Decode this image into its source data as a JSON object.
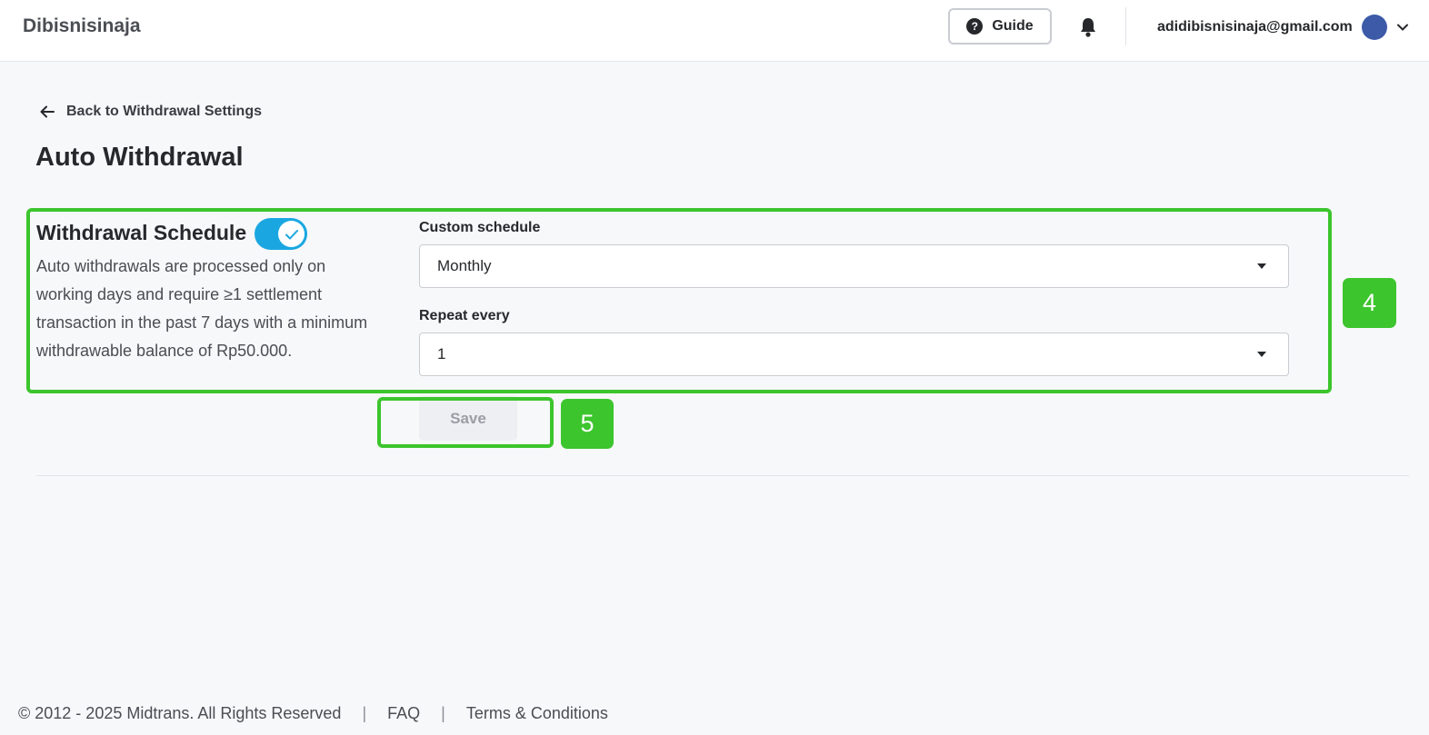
{
  "header": {
    "brand": "Dibisnisinaja",
    "guide_label": "Guide",
    "user_email": "adidibisnisinaja@gmail.com"
  },
  "nav": {
    "back_label": "Back to Withdrawal Settings"
  },
  "page": {
    "title": "Auto Withdrawal"
  },
  "schedule": {
    "title": "Withdrawal Schedule",
    "enabled": true,
    "description": "Auto withdrawals are processed only on working days and require ≥1 settlement transaction in the past 7 days with a minimum withdrawable balance of Rp50.000.",
    "custom_schedule_label": "Custom schedule",
    "custom_schedule_value": "Monthly",
    "repeat_every_label": "Repeat every",
    "repeat_every_value": "1",
    "save_label": "Save"
  },
  "annotations": {
    "badge_4": "4",
    "badge_5": "5",
    "highlight_color": "#3cc52d"
  },
  "footer": {
    "copyright": "© 2012 - 2025 Midtrans. All Rights Reserved",
    "separator": "|",
    "faq_label": "FAQ",
    "terms_label": "Terms & Conditions"
  },
  "colors": {
    "toggle_on": "#1aa7e1",
    "avatar": "#3c5aa8"
  }
}
